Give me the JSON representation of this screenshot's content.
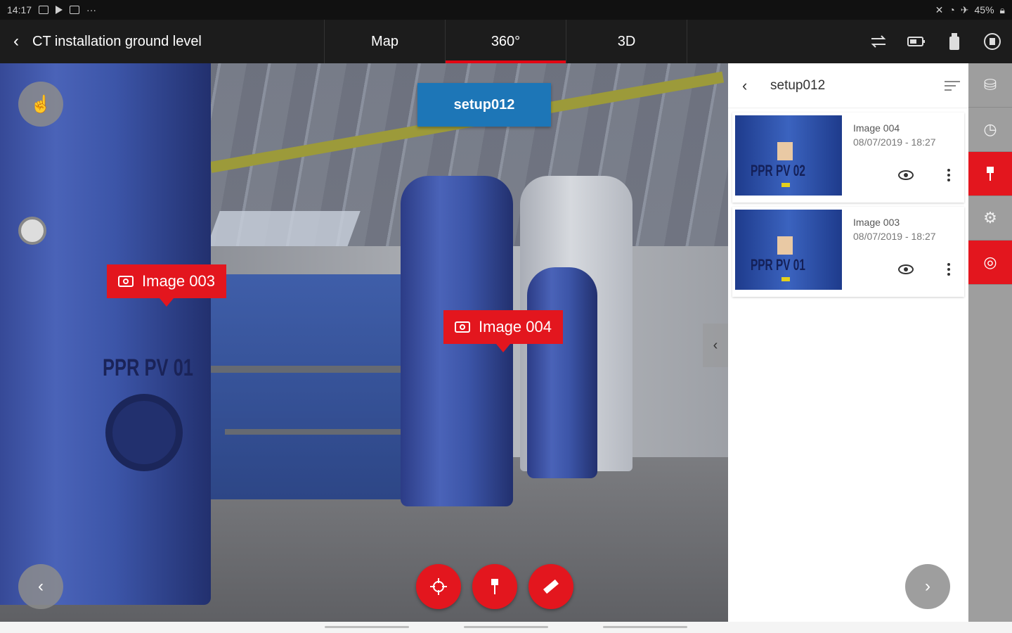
{
  "status_bar": {
    "time": "14:17",
    "battery": "45%",
    "more": "···"
  },
  "app_bar": {
    "back_icon": "chevron-left-icon",
    "title": "CT installation ground level",
    "tabs": [
      {
        "label": "Map",
        "active": false
      },
      {
        "label": "360°",
        "active": true
      },
      {
        "label": "3D",
        "active": false
      }
    ],
    "actions": [
      "swap-arrows-icon",
      "battery-icon",
      "device-icon",
      "info-icon"
    ]
  },
  "viewer": {
    "setup_label": "setup012",
    "pins": [
      {
        "label": "Image  003"
      },
      {
        "label": "Image  004"
      }
    ],
    "tank_labels": [
      "PPR  PV 01"
    ],
    "bottom_tools": [
      "target-icon",
      "pin-icon",
      "ruler-icon"
    ],
    "collapse_icon": "‹"
  },
  "panel": {
    "title": "setup012",
    "images": [
      {
        "name": "Image 004",
        "date": "08/07/2019 - 18:27",
        "thumb_text": "PPR  PV  02"
      },
      {
        "name": "Image 003",
        "date": "08/07/2019 - 18:27",
        "thumb_text": "PPR  PV 01"
      }
    ]
  },
  "rail": {
    "items": [
      {
        "icon": "layers-icon",
        "active": false
      },
      {
        "icon": "clock-icon",
        "active": false
      },
      {
        "icon": "pin-icon",
        "active": true
      },
      {
        "icon": "gear-icon",
        "active": false
      },
      {
        "icon": "target-icon",
        "active": true
      }
    ]
  },
  "colors": {
    "accent": "#e3161e",
    "setup_blue": "#1d76b7",
    "rail": "#9e9e9e",
    "appbar": "#1c1c1c"
  }
}
